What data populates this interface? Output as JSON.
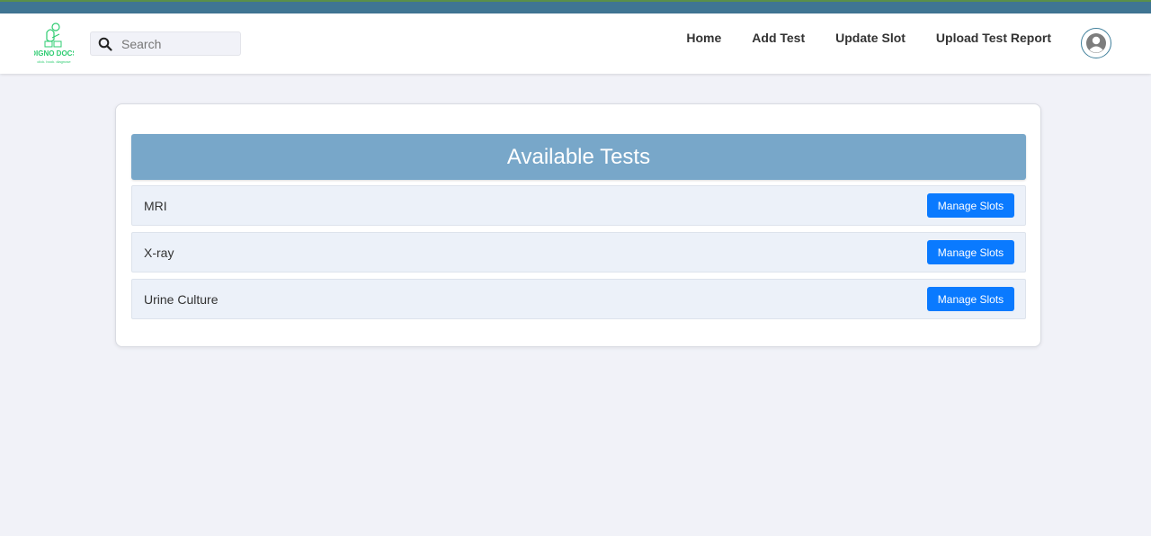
{
  "header": {
    "logo": {
      "icon": "digno-docs-logo",
      "title": "DIGNO DOCS",
      "tagline": "click. book. diagnose",
      "color": "#2ecc71"
    },
    "search": {
      "placeholder": "Search",
      "value": "",
      "icon": "search-icon"
    },
    "nav": [
      {
        "label": "Home"
      },
      {
        "label": "Add Test"
      },
      {
        "label": "Update Slot"
      },
      {
        "label": "Upload Test Report"
      }
    ],
    "avatar_icon": "user-circle-icon"
  },
  "main": {
    "title": "Available Tests",
    "tests": [
      {
        "name": "MRI",
        "action": "Manage Slots"
      },
      {
        "name": "X-ray",
        "action": "Manage Slots"
      },
      {
        "name": "Urine Culture",
        "action": "Manage Slots"
      }
    ]
  },
  "colors": {
    "top_strip": "#3f7593",
    "header_bar": "#78a7c9",
    "button": "#0a7aff",
    "row_bg": "#ecf1f9",
    "page_bg": "#f1f2f8"
  }
}
